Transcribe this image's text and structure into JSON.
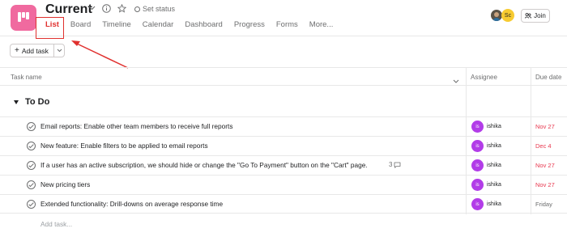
{
  "header": {
    "title": "Current",
    "set_status": "Set status",
    "join_label": "Join",
    "avatar_initials": "Sc",
    "accent": "#f06a9f"
  },
  "tabs": [
    {
      "label": "List",
      "active": true
    },
    {
      "label": "Board"
    },
    {
      "label": "Timeline"
    },
    {
      "label": "Calendar"
    },
    {
      "label": "Dashboard"
    },
    {
      "label": "Progress"
    },
    {
      "label": "Forms"
    },
    {
      "label": "More..."
    }
  ],
  "toolbar": {
    "add_task_label": "Add task"
  },
  "columns": {
    "task_name": "Task name",
    "assignee": "Assignee",
    "due_date": "Due date"
  },
  "section": {
    "title": "To Do"
  },
  "tasks": [
    {
      "name": "Email reports: Enable other team members to receive full reports",
      "assignee": "ishika",
      "initials": "is",
      "due": "Nov 27",
      "due_color": "#e8384f"
    },
    {
      "name": "New feature: Enable filters to be applied to email reports",
      "assignee": "ishika",
      "initials": "is",
      "due": "Dec 4",
      "due_color": "#e8384f"
    },
    {
      "name": "If a user has an active subscription, we should hide or change the \"Go To Payment\" button on the \"Cart\" page.",
      "subtasks": "3",
      "assignee": "ishika",
      "initials": "is",
      "due": "Nov 27",
      "due_color": "#e8384f"
    },
    {
      "name": "New pricing tiers",
      "assignee": "ishika",
      "initials": "is",
      "due": "Nov 27",
      "due_color": "#e8384f"
    },
    {
      "name": "Extended functionality: Drill-downs on average response time",
      "assignee": "ishika",
      "initials": "is",
      "due": "Friday",
      "due_color": "#6d6e6f"
    }
  ],
  "add_task_link": "Add task...",
  "colors": {
    "annotation": "#e0302e",
    "assignee_avatar": "#b23ce8"
  }
}
